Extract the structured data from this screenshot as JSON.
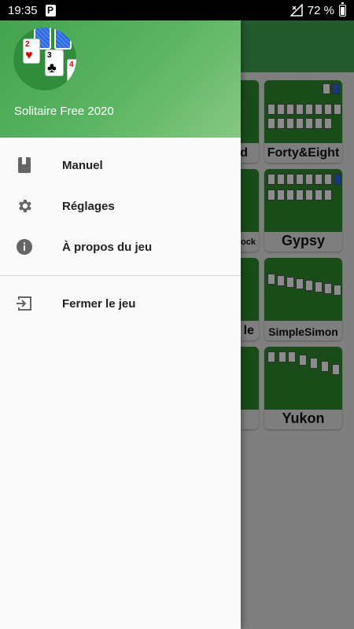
{
  "status_bar": {
    "time": "19:35",
    "notification_icon": "p-icon",
    "battery_percent": "72 %",
    "signal_icon": "no-signal-icon",
    "battery_icon": "battery-icon"
  },
  "drawer": {
    "app_title": "Solitaire Free 2020",
    "logo_icon": "solitaire-cards-logo",
    "items": [
      {
        "label": "Manuel",
        "icon": "book-icon"
      },
      {
        "label": "Réglages",
        "icon": "gear-icon"
      },
      {
        "label": "À propos du jeu",
        "icon": "info-icon"
      },
      {
        "label": "Fermer le jeu",
        "icon": "exit-icon"
      }
    ]
  },
  "background_games": [
    {
      "name": "d"
    },
    {
      "name": "Forty&Eight"
    },
    {
      "name": "lock"
    },
    {
      "name": "Gypsy"
    },
    {
      "name": "le"
    },
    {
      "name": "SimpleSimon"
    },
    {
      "name": ""
    },
    {
      "name": "Yukon"
    }
  ],
  "colors": {
    "header_green": "#43a34f",
    "felt_green": "#2e8b2e",
    "drawer_bg": "#fafafa"
  }
}
